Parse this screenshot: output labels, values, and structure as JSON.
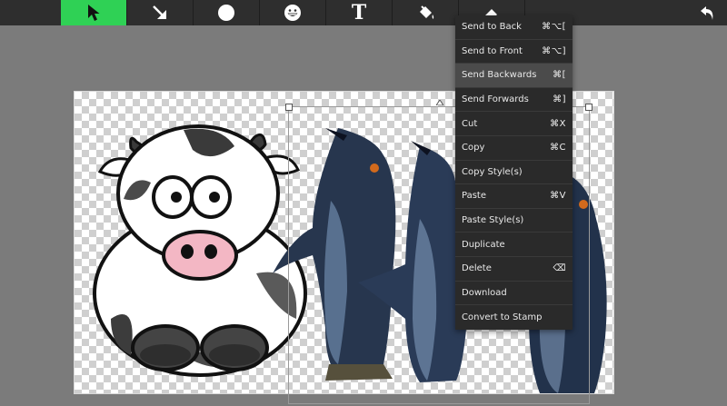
{
  "toolbar": {
    "tools": [
      {
        "icon": "select-arrow-icon",
        "active": true
      },
      {
        "icon": "line-arrow-icon",
        "active": false
      },
      {
        "icon": "circle-icon",
        "active": false
      },
      {
        "icon": "emoji-icon",
        "active": false
      },
      {
        "icon": "text-icon",
        "active": false,
        "glyph": "T"
      },
      {
        "icon": "paint-bucket-icon",
        "active": false
      },
      {
        "icon": "eraser-icon",
        "active": false
      }
    ],
    "undo_icon": "undo-icon",
    "colors": {
      "bar": "#2e2e2e",
      "active": "#2fd155"
    }
  },
  "canvas": {
    "images": [
      "cow-clipart",
      "penguins-photo"
    ]
  },
  "context_menu": {
    "items": [
      {
        "label": "Send to Back",
        "shortcut": "⌘⌥["
      },
      {
        "label": "Send to Front",
        "shortcut": "⌘⌥]"
      },
      {
        "label": "Send Backwards",
        "shortcut": "⌘[",
        "highlighted": true
      },
      {
        "label": "Send Forwards",
        "shortcut": "⌘]"
      },
      {
        "label": "Cut",
        "shortcut": "⌘X"
      },
      {
        "label": "Copy",
        "shortcut": "⌘C"
      },
      {
        "label": "Copy Style(s)",
        "shortcut": ""
      },
      {
        "label": "Paste",
        "shortcut": "⌘V"
      },
      {
        "label": "Paste Style(s)",
        "shortcut": ""
      },
      {
        "label": "Duplicate",
        "shortcut": ""
      },
      {
        "label": "Delete",
        "shortcut": "⌫"
      },
      {
        "label": "Download",
        "shortcut": ""
      },
      {
        "label": "Convert to Stamp",
        "shortcut": ""
      }
    ]
  }
}
